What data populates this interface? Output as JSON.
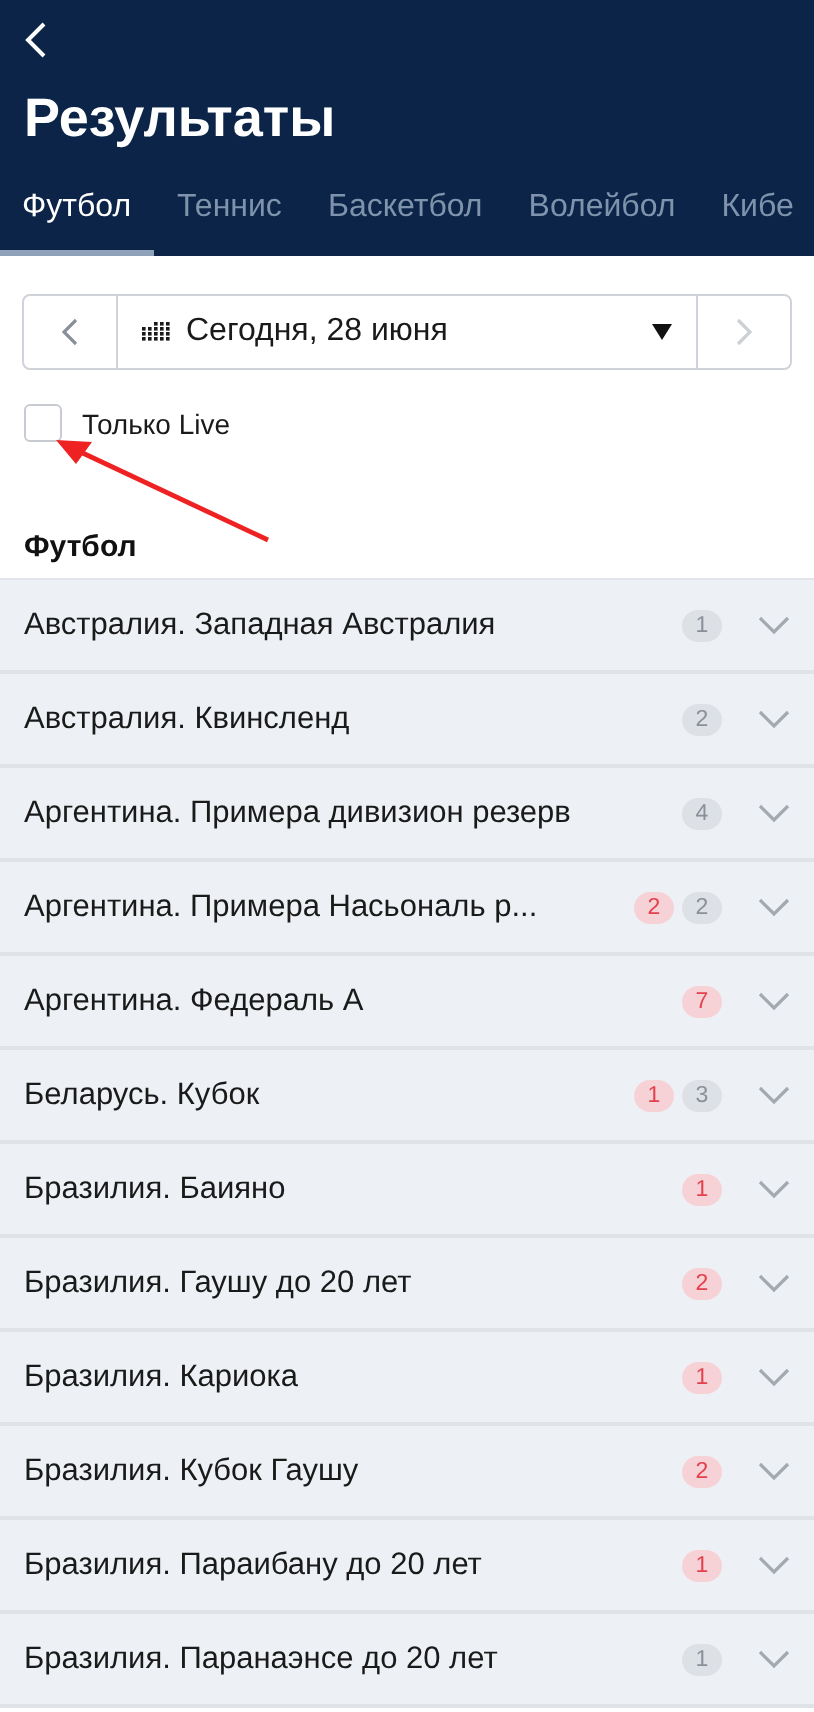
{
  "header": {
    "title": "Результаты"
  },
  "tabs": [
    {
      "label": "Футбол",
      "selected": true
    },
    {
      "label": "Теннис",
      "selected": false
    },
    {
      "label": "Баскетбол",
      "selected": false
    },
    {
      "label": "Волейбол",
      "selected": false
    },
    {
      "label": "Кибе",
      "selected": false
    }
  ],
  "date_picker": {
    "value": "Сегодня, 28 июня",
    "prev_disabled": false,
    "next_disabled": true
  },
  "live_filter": {
    "label": "Только Live",
    "checked": false
  },
  "section": {
    "title": "Футбол"
  },
  "leagues": [
    {
      "name": "Австралия. Западная Австралия",
      "badges": [
        {
          "kind": "total",
          "text": "1"
        }
      ]
    },
    {
      "name": "Австралия. Квинсленд",
      "badges": [
        {
          "kind": "total",
          "text": "2"
        }
      ]
    },
    {
      "name": "Аргентина. Примера дивизион резерв",
      "badges": [
        {
          "kind": "total",
          "text": "4"
        }
      ]
    },
    {
      "name": "Аргентина. Примера Насьональ р...",
      "badges": [
        {
          "kind": "live",
          "text": "2"
        },
        {
          "kind": "total",
          "text": "2"
        }
      ]
    },
    {
      "name": "Аргентина. Федераль А",
      "badges": [
        {
          "kind": "live",
          "text": "7"
        }
      ]
    },
    {
      "name": "Беларусь. Кубок",
      "badges": [
        {
          "kind": "live",
          "text": "1"
        },
        {
          "kind": "total",
          "text": "3"
        }
      ]
    },
    {
      "name": "Бразилия. Баияно",
      "badges": [
        {
          "kind": "live",
          "text": "1"
        }
      ]
    },
    {
      "name": "Бразилия. Гаушу до 20 лет",
      "badges": [
        {
          "kind": "live",
          "text": "2"
        }
      ]
    },
    {
      "name": "Бразилия. Кариока",
      "badges": [
        {
          "kind": "live",
          "text": "1"
        }
      ]
    },
    {
      "name": "Бразилия. Кубок Гаушу",
      "badges": [
        {
          "kind": "live",
          "text": "2"
        }
      ]
    },
    {
      "name": "Бразилия. Параибану до 20 лет",
      "badges": [
        {
          "kind": "live",
          "text": "1"
        }
      ]
    },
    {
      "name": "Бразилия. Паранаэнсе до 20 лет",
      "badges": [
        {
          "kind": "total",
          "text": "1"
        }
      ]
    }
  ]
}
